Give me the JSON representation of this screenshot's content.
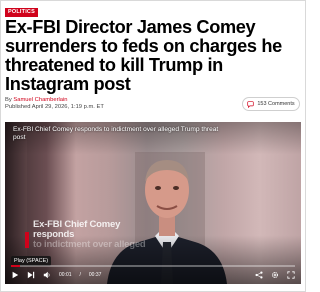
{
  "article": {
    "section_tag": "POLITICS",
    "headline": "Ex-FBI Director James Comey surrenders to feds on charges he threatened to kill Trump in Instagram post",
    "byline_prefix": "By ",
    "author": "Samuel Chamberlain",
    "published": "Published April 29, 2026, 1:19 p.m. ET",
    "comments_label": "153 Comments"
  },
  "video": {
    "title": "Ex-FBI Chief Comey responds to indictment over alleged Trump threat post",
    "lower_third_line1": "Ex-FBI Chief Comey responds",
    "lower_third_line2": "to indictment over alleged",
    "play_tooltip": "Play (SPACE)",
    "current_time": "00:01",
    "duration": "00:37",
    "progress_fraction": 0.03
  },
  "colors": {
    "brand_red": "#d0021b"
  },
  "icons": [
    "comment-icon",
    "play-icon",
    "next-icon",
    "volume-icon",
    "share-icon",
    "settings-icon",
    "fullscreen-icon"
  ]
}
